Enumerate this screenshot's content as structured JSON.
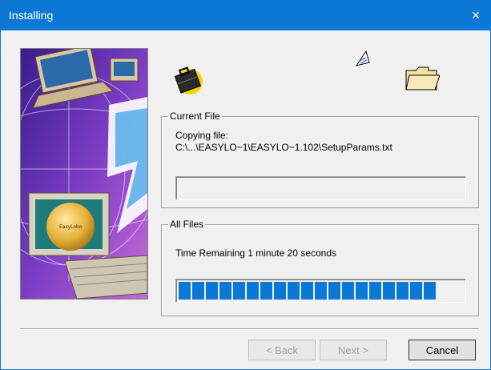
{
  "window": {
    "title": "Installing",
    "close_glyph": "×"
  },
  "art": {
    "globe_text": "EasyLobo"
  },
  "icons": [
    "briefcase-icon",
    "flying-page-icon",
    "folder-icon"
  ],
  "current_file": {
    "legend": "Current File",
    "line1": "Copying file:",
    "line2": "C:\\...\\EASYLO~1\\EASYLO~1.102\\SetupParams.txt",
    "progress": 0
  },
  "all_files": {
    "legend": "All Files",
    "time_remaining": "Time Remaining 1 minute  20 seconds",
    "progress_segments_filled": 19
  },
  "buttons": {
    "back": "< Back",
    "next": "Next >",
    "cancel": "Cancel"
  },
  "colors": {
    "accent": "#0a78d4"
  }
}
